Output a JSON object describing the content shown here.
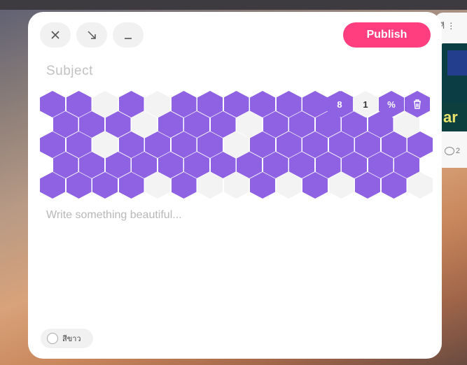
{
  "window": {
    "close_icon": "close-icon",
    "minimize_icon": "collapse-arrow-icon",
    "dash_icon": "minimize-icon"
  },
  "publish_label": "Publish",
  "subject_placeholder": "Subject",
  "body_placeholder": "Write something beautiful...",
  "controls": {
    "count": "8",
    "step": "1",
    "percent": "%",
    "delete_icon": "trash-icon"
  },
  "language_toggle": "สีขาว",
  "right_card": {
    "menu": "ที ⋮",
    "banner_text": "ar",
    "comment_count": "2"
  },
  "colors": {
    "accent": "#ff3e80",
    "hex_on": "#8e62e2",
    "hex_off": "#f3f3f3"
  },
  "hex_grid": [
    [
      1,
      1,
      0,
      1,
      0,
      1,
      1,
      1,
      1,
      1,
      1,
      1
    ],
    [
      1,
      1,
      1,
      0,
      1,
      1,
      1,
      0,
      1,
      1,
      1,
      1,
      1,
      0
    ],
    [
      1,
      1,
      0,
      1,
      1,
      1,
      1,
      0,
      1,
      1,
      1,
      1,
      1,
      1,
      1
    ],
    [
      1,
      1,
      1,
      1,
      1,
      1,
      1,
      1,
      1,
      1,
      1,
      1,
      1,
      1
    ],
    [
      1,
      1,
      1,
      1,
      0,
      1,
      0,
      0,
      1,
      0,
      1,
      0,
      1,
      1,
      0
    ]
  ]
}
